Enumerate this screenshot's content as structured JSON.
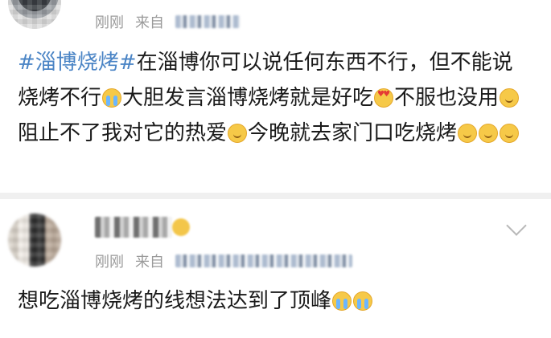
{
  "comments": [
    {
      "time": "刚刚",
      "source_prefix": "来自",
      "text_segments": [
        {
          "type": "hashtag",
          "text": "#淄博烧烤#"
        },
        {
          "type": "text",
          "text": "在淄博你可以说任何东西不行，但不能说烧烤不行"
        },
        {
          "type": "emoji",
          "icon": "crying-face-icon"
        },
        {
          "type": "text",
          "text": "大胆发言淄博烧烤就是好吃"
        },
        {
          "type": "emoji",
          "icon": "heart-eyes-icon"
        },
        {
          "type": "text",
          "text": "不服也没用"
        },
        {
          "type": "emoji",
          "icon": "smile-face-icon"
        },
        {
          "type": "text",
          "text": "阻止不了我对它的热爱"
        },
        {
          "type": "emoji",
          "icon": "wink-face-icon"
        },
        {
          "type": "text",
          "text": "今晚就去家门口吃烧烤"
        },
        {
          "type": "emoji",
          "icon": "smile-face-icon"
        },
        {
          "type": "emoji",
          "icon": "smile-face-icon"
        },
        {
          "type": "emoji",
          "icon": "smile-face-icon"
        }
      ]
    },
    {
      "time": "刚刚",
      "source_prefix": "来自",
      "text": "想吃淄博烧烤的线想法达到了顶峰",
      "trailing_emojis": [
        "crying-face-icon",
        "crying-face-icon"
      ]
    }
  ],
  "colors": {
    "hashtag": "#4a84c5",
    "meta_text": "#9a9a9a",
    "body_text": "#1a1a1a"
  }
}
